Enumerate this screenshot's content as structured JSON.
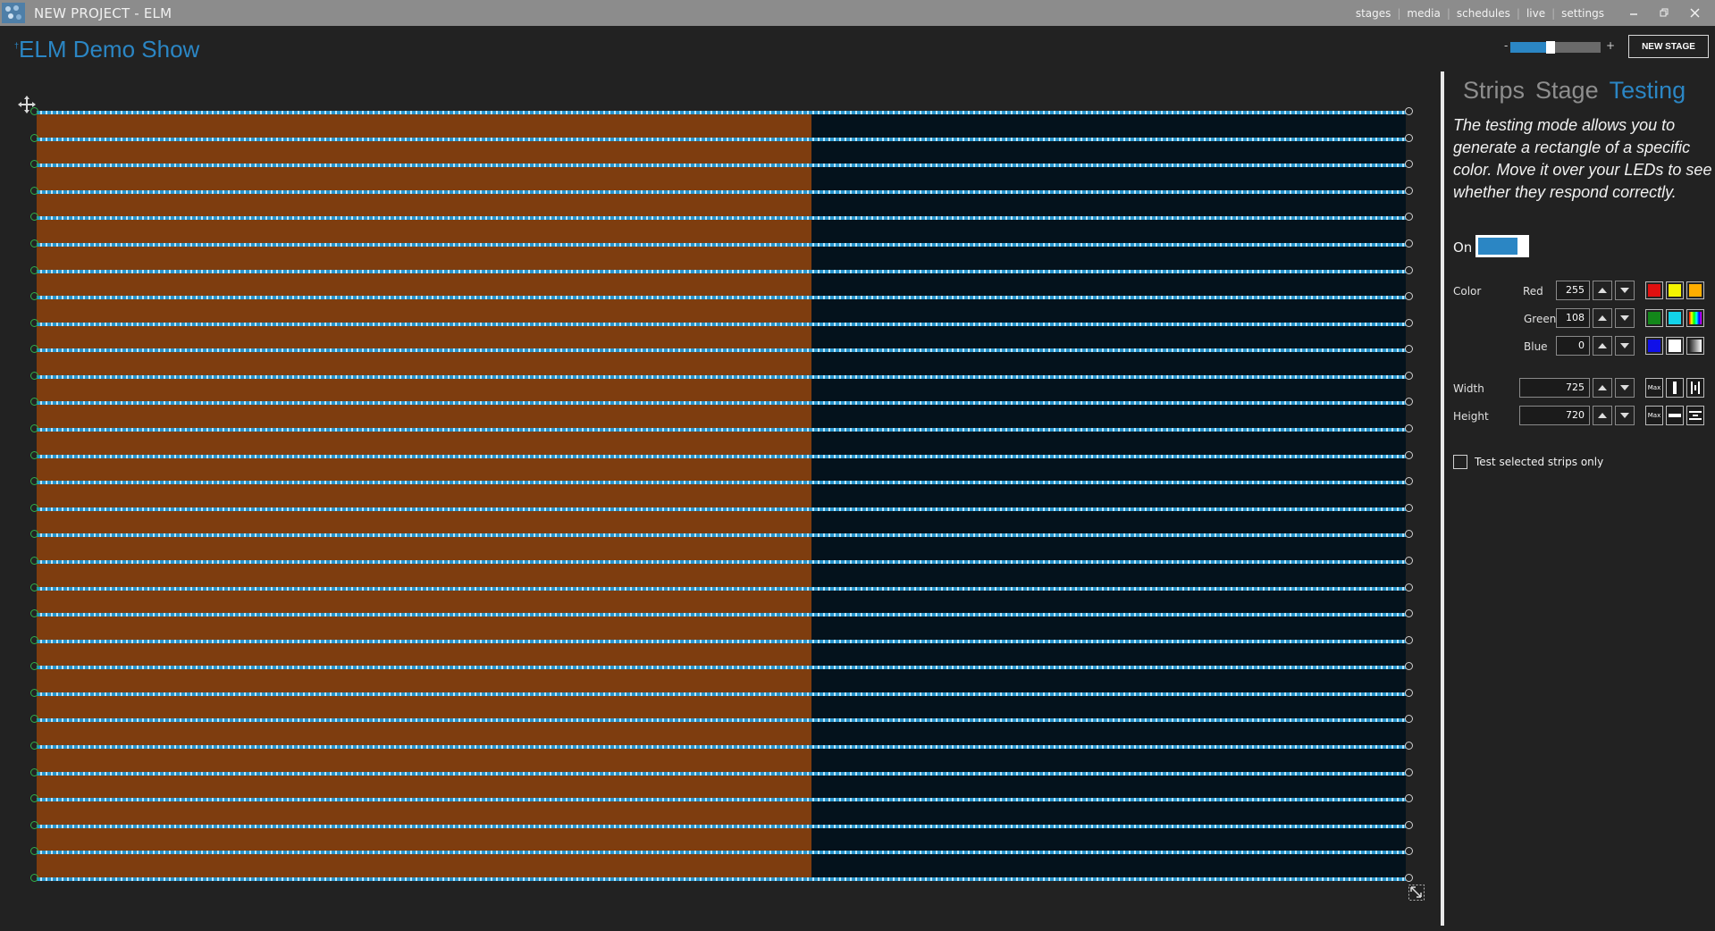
{
  "window": {
    "title": "NEW PROJECT - ELM"
  },
  "nav": {
    "items": [
      "stages",
      "media",
      "schedules",
      "live",
      "settings"
    ]
  },
  "project": {
    "title": "ELM Demo Show",
    "marker": "†"
  },
  "zoom": {
    "minus": "-",
    "plus": "+",
    "level": 0.4
  },
  "toolbar": {
    "new_stage": "NEW STAGE"
  },
  "stage": {
    "strip_count": 30,
    "test_rect_fraction": 0.566
  },
  "panel": {
    "tabs": [
      "Strips",
      "Stage",
      "Testing"
    ],
    "active_tab": "Testing",
    "description": "The testing mode allows you to generate a rectangle of a specific color. Move it over your LEDs to see whether they respond correctly.",
    "on_label": "On",
    "color_label": "Color",
    "red_label": "Red",
    "red": "255",
    "green_label": "Green",
    "green": "108",
    "blue_label": "Blue",
    "blue": "0",
    "width_label": "Width",
    "width": "725",
    "height_label": "Height",
    "height": "720",
    "max_label": "Max",
    "test_selected_label": "Test selected strips only"
  },
  "colors": {
    "accent": "#2b86c4",
    "test_rect": "#7e3d0f",
    "stage_bg": "#04121c",
    "swatches": [
      "#e01010",
      "#f5f500",
      "#ffae00",
      "#13871a",
      "#12d3ea",
      "rainbow",
      "#1010e8",
      "#ffffff",
      "gradient"
    ]
  }
}
